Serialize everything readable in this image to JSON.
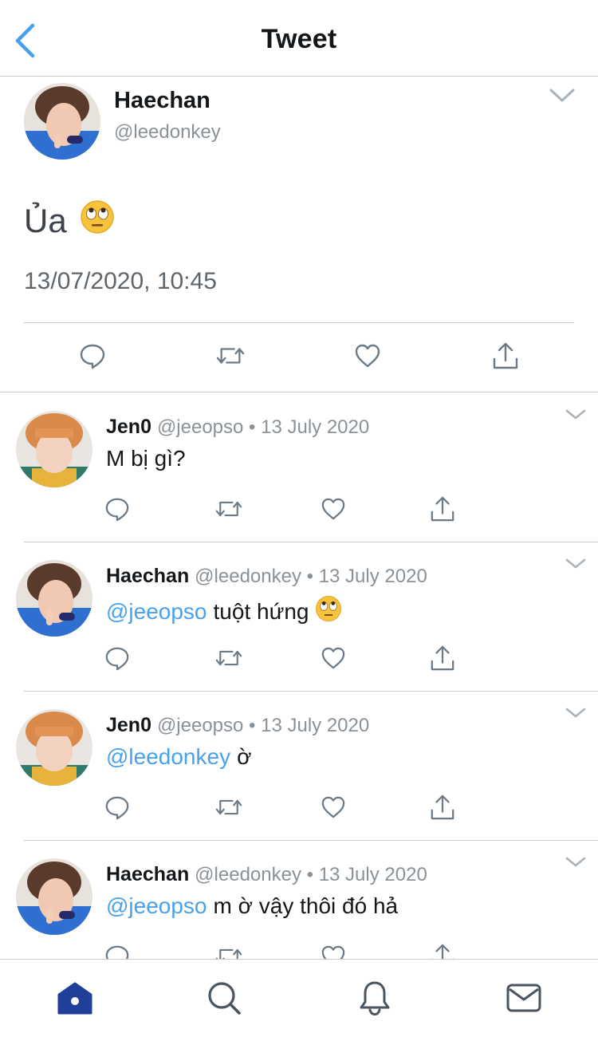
{
  "header": {
    "title": "Tweet"
  },
  "colors": {
    "link": "#4aa1eb",
    "icon": "#6b7a86",
    "tab_active": "#1f3f9a",
    "tab_inactive": "#4a5560"
  },
  "main_tweet": {
    "name": "Haechan",
    "handle": "@leedonkey",
    "text": "Ủa",
    "emoji": "face-with-rolling-eyes",
    "timestamp": "13/07/2020, 10:45"
  },
  "replies": [
    {
      "name": "Jen0",
      "meta": "@jeeopso • 13 July 2020",
      "mention": "",
      "text": "M bị gì?",
      "emoji": ""
    },
    {
      "name": "Haechan",
      "meta": "@leedonkey • 13 July 2020",
      "mention": "@jeeopso",
      "text": "tuột hứng",
      "emoji": "face-with-rolling-eyes"
    },
    {
      "name": "Jen0",
      "meta": "@jeeopso • 13 July 2020",
      "mention": "@leedonkey",
      "text": "ờ",
      "emoji": ""
    },
    {
      "name": "Haechan",
      "meta": "@leedonkey • 13 July 2020",
      "mention": "@jeeopso",
      "text": "m ờ vậy thôi đó hả",
      "emoji": ""
    }
  ],
  "tabbar": {
    "items": [
      "home-icon",
      "search-icon",
      "notifications-icon",
      "messages-icon"
    ],
    "active": "home-icon"
  }
}
